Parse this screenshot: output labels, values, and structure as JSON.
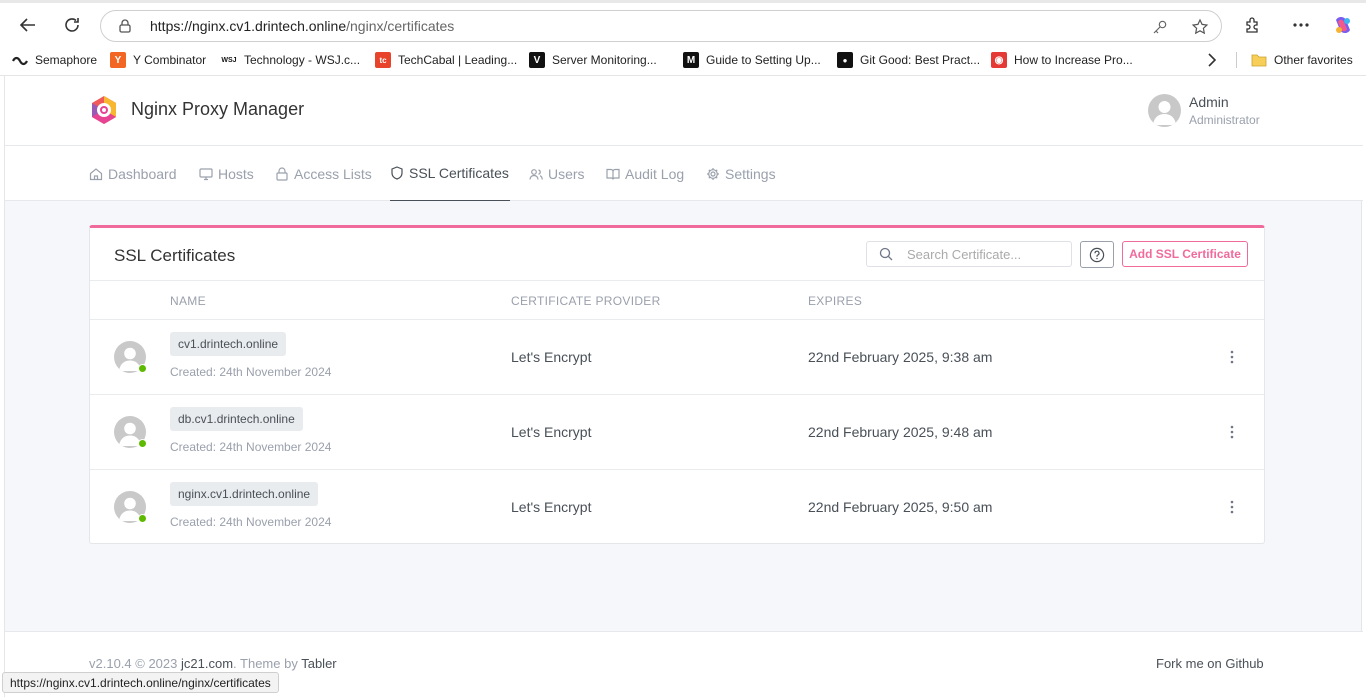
{
  "browser": {
    "url_host": "https://nginx.cv1.drintech.online",
    "url_path": "/nginx/certificates",
    "status_url": "https://nginx.cv1.drintech.online/nginx/certificates"
  },
  "favorites": [
    {
      "label": "Semaphore",
      "icon": "semaphore-icon",
      "color": "#222222"
    },
    {
      "label": "Y Combinator",
      "icon": "ycombinator-icon",
      "glyph": "Y",
      "color": "#f26522"
    },
    {
      "label": "Technology - WSJ.c...",
      "icon": "wsj-icon",
      "glyph": "WSJ",
      "color": "#ffffff"
    },
    {
      "label": "TechCabal | Leading...",
      "icon": "techcabal-icon",
      "glyph": "tc",
      "color": "#e8442c"
    },
    {
      "label": "Server Monitoring...",
      "icon": "v-icon",
      "glyph": "V",
      "color": "#111111"
    },
    {
      "label": "Guide to Setting Up...",
      "icon": "medium-icon",
      "glyph": "M",
      "color": "#111111"
    },
    {
      "label": "Git Good: Best Pract...",
      "icon": "gitgood-icon",
      "glyph": "●",
      "color": "#111111"
    },
    {
      "label": "How to Increase Pro...",
      "icon": "record-icon",
      "glyph": "◉",
      "color": "#e53935"
    }
  ],
  "other_favorites": "Other favorites",
  "app": {
    "brand": "Nginx Proxy Manager",
    "user_name": "Admin",
    "user_role": "Administrator",
    "nav": [
      {
        "label": "Dashboard",
        "icon": "home-icon",
        "active": false
      },
      {
        "label": "Hosts",
        "icon": "monitor-icon",
        "active": false
      },
      {
        "label": "Access Lists",
        "icon": "lock-icon",
        "active": false
      },
      {
        "label": "SSL Certificates",
        "icon": "shield-icon",
        "active": true
      },
      {
        "label": "Users",
        "icon": "users-icon",
        "active": false
      },
      {
        "label": "Audit Log",
        "icon": "book-icon",
        "active": false
      },
      {
        "label": "Settings",
        "icon": "gear-icon",
        "active": false
      }
    ]
  },
  "card": {
    "title": "SSL Certificates",
    "search_placeholder": "Search Certificate...",
    "add_button": "Add SSL Certificate",
    "columns": [
      "NAME",
      "CERTIFICATE PROVIDER",
      "EXPIRES"
    ],
    "rows": [
      {
        "domain": "cv1.drintech.online",
        "created": "Created: 24th November 2024",
        "provider": "Let's Encrypt",
        "expires": "22nd February 2025, 9:38 am"
      },
      {
        "domain": "db.cv1.drintech.online",
        "created": "Created: 24th November 2024",
        "provider": "Let's Encrypt",
        "expires": "22nd February 2025, 9:48 am"
      },
      {
        "domain": "nginx.cv1.drintech.online",
        "created": "Created: 24th November 2024",
        "provider": "Let's Encrypt",
        "expires": "22nd February 2025, 9:50 am"
      }
    ]
  },
  "footer": {
    "version": "v2.10.4 © 2023",
    "author": "jc21.com",
    "theme_by": ". Theme by",
    "theme": "Tabler",
    "fork": "Fork me on Github"
  },
  "colors": {
    "accent": "#f06b9c",
    "online": "#5eba00"
  }
}
